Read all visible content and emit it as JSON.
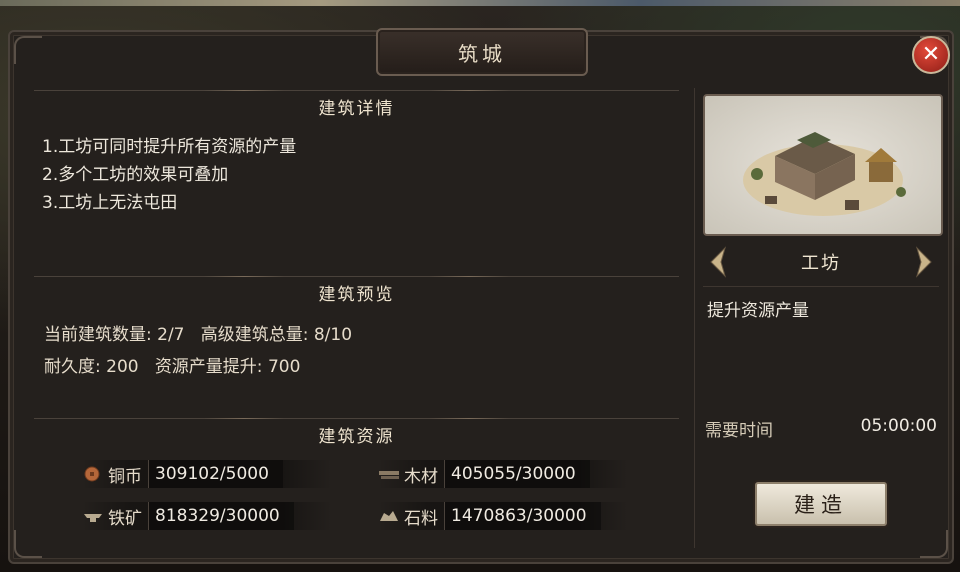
{
  "window": {
    "title": "筑城"
  },
  "details": {
    "heading": "建筑详情",
    "lines": [
      "1.工坊可同时提升所有资源的产量",
      "2.多个工坊的效果可叠加",
      "3.工坊上无法屯田"
    ]
  },
  "preview": {
    "heading": "建筑预览",
    "count_label": "当前建筑数量:",
    "count_value": "2/7",
    "total_label": "高级建筑总量:",
    "total_value": "8/10",
    "durability_label": "耐久度:",
    "durability_value": "200",
    "boost_label": "资源产量提升:",
    "boost_value": "700"
  },
  "resources": {
    "heading": "建筑资源",
    "copper": {
      "icon": "copper-coin-icon",
      "name": "铜币",
      "value": "309102/5000"
    },
    "wood": {
      "icon": "wood-log-icon",
      "name": "木材",
      "value": "405055/30000"
    },
    "iron": {
      "icon": "iron-ore-icon",
      "name": "铁矿",
      "value": "818329/30000"
    },
    "stone": {
      "icon": "stone-icon",
      "name": "石料",
      "value": "1470863/30000"
    }
  },
  "building": {
    "name": "工坊",
    "description": "提升资源产量",
    "time_label": "需要时间",
    "time_value": "05:00:00",
    "build_label": "建造"
  },
  "colors": {
    "panel": "#24201d",
    "border": "#4a423b",
    "close": "#c8352b",
    "button": "#e3dccd"
  }
}
